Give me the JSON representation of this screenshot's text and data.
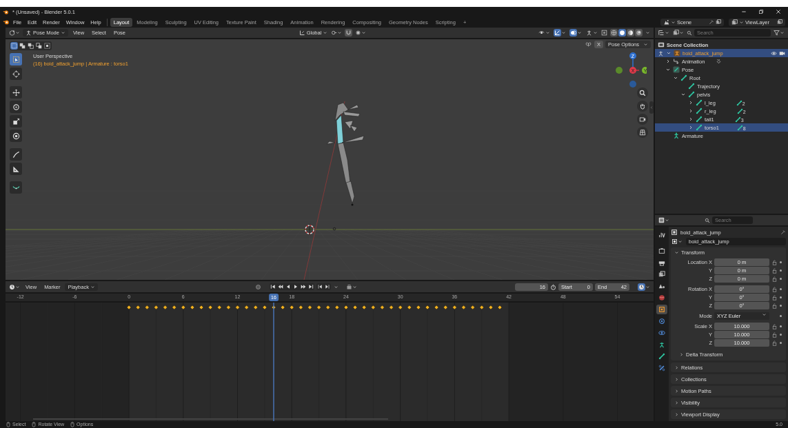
{
  "window": {
    "title": "* (Unsaved) - Blender 5.0.1"
  },
  "menu": [
    "File",
    "Edit",
    "Render",
    "Window",
    "Help"
  ],
  "workspaces": [
    {
      "label": "Layout",
      "selected": true
    },
    {
      "label": "Modeling",
      "selected": false
    },
    {
      "label": "Sculpting",
      "selected": false
    },
    {
      "label": "UV Editing",
      "selected": false
    },
    {
      "label": "Texture Paint",
      "selected": false
    },
    {
      "label": "Shading",
      "selected": false
    },
    {
      "label": "Animation",
      "selected": false
    },
    {
      "label": "Rendering",
      "selected": false
    },
    {
      "label": "Compositing",
      "selected": false
    },
    {
      "label": "Geometry Nodes",
      "selected": false
    },
    {
      "label": "Scripting",
      "selected": false
    }
  ],
  "add_workspace": "+",
  "scene": "Scene",
  "view_layer": "ViewLayer",
  "viewport": {
    "mode": "Pose Mode",
    "menus": [
      "View",
      "Select",
      "Pose"
    ],
    "orientation": "Global",
    "pose_options": "Pose Options",
    "mirror_toggle": "X",
    "select_modes": [
      {
        "selected": true
      },
      {
        "selected": false
      },
      {
        "selected": false
      },
      {
        "selected": false
      },
      {
        "selected": false
      }
    ],
    "shading": [
      {
        "kind": "wireframe",
        "selected": false
      },
      {
        "kind": "solid",
        "selected": true
      },
      {
        "kind": "material",
        "selected": false
      },
      {
        "kind": "rendered",
        "selected": false
      }
    ],
    "tools": [
      {
        "kind": "select",
        "selected": true
      },
      {
        "kind": "cursor",
        "selected": false
      },
      {
        "kind": "move",
        "selected": false
      },
      {
        "kind": "rotate",
        "selected": false
      },
      {
        "kind": "scale",
        "selected": false
      },
      {
        "kind": "transform",
        "selected": false
      },
      {
        "kind": "annotate",
        "selected": false
      },
      {
        "kind": "measure",
        "selected": false
      },
      {
        "kind": "relax",
        "selected": false
      }
    ],
    "view_name": "User Perspective",
    "info": "(16) boid_attack_jump | Armature : torso1",
    "gizmo_labels": [
      "Z",
      "X",
      "Y"
    ]
  },
  "outliner": {
    "search_placeholder": "Search",
    "root": "Scene Collection",
    "items": [
      {
        "label": "boid_attack_jump",
        "kind": "armature_object",
        "selected": true,
        "expanded": true,
        "children": [
          {
            "label": "Animation",
            "kind": "animation",
            "selected": false,
            "expanded": false
          },
          {
            "label": "Pose",
            "kind": "pose",
            "selected": false,
            "expanded": true,
            "children": [
              {
                "label": "Root",
                "kind": "bone",
                "selected": false,
                "expanded": true,
                "children": [
                  {
                    "label": "Trajectory",
                    "kind": "bone",
                    "selected": false
                  },
                  {
                    "label": "pelvis",
                    "kind": "bone",
                    "selected": false,
                    "expanded": true,
                    "children": [
                      {
                        "label": "l_leg",
                        "kind": "bone",
                        "selected": false,
                        "expanded": false,
                        "count": "2"
                      },
                      {
                        "label": "r_leg",
                        "kind": "bone",
                        "selected": false,
                        "expanded": false,
                        "count": "2"
                      },
                      {
                        "label": "tail1",
                        "kind": "bone",
                        "selected": false,
                        "expanded": false,
                        "count": "3"
                      },
                      {
                        "label": "torso1",
                        "kind": "bone",
                        "selected": true,
                        "expanded": false,
                        "count": "8"
                      }
                    ]
                  }
                ]
              }
            ]
          },
          {
            "label": "Armature",
            "kind": "armature_data",
            "selected": false
          }
        ]
      }
    ]
  },
  "properties": {
    "search_placeholder": "Search",
    "tabs": [
      {
        "kind": "tool",
        "selected": false
      },
      {
        "kind": "render",
        "selected": false
      },
      {
        "kind": "output",
        "selected": false
      },
      {
        "kind": "view_layer",
        "selected": false
      },
      {
        "kind": "scene",
        "selected": false
      },
      {
        "kind": "world",
        "selected": false
      },
      {
        "kind": "object",
        "selected": true
      },
      {
        "kind": "modifiers",
        "selected": false
      },
      {
        "kind": "physics",
        "selected": false
      },
      {
        "kind": "armature",
        "selected": false
      },
      {
        "kind": "bone",
        "selected": false
      },
      {
        "kind": "constraints",
        "selected": false
      }
    ],
    "object_name": "boid_attack_jump",
    "datablock": "boid_attack_jump",
    "panels": [
      {
        "title": "Transform",
        "expanded": true,
        "groups": [
          [
            {
              "label": "Location X",
              "value": "0 m",
              "kind": "number"
            },
            {
              "label": "Y",
              "value": "0 m",
              "kind": "number"
            },
            {
              "label": "Z",
              "value": "0 m",
              "kind": "number"
            }
          ],
          [
            {
              "label": "Rotation X",
              "value": "0°",
              "kind": "number"
            },
            {
              "label": "Y",
              "value": "0°",
              "kind": "number"
            },
            {
              "label": "Z",
              "value": "0°",
              "kind": "number"
            }
          ],
          [
            {
              "label": "Mode",
              "value": "XYZ Euler",
              "kind": "dropdown"
            }
          ],
          [
            {
              "label": "Scale X",
              "value": "10.000",
              "kind": "number"
            },
            {
              "label": "Y",
              "value": "10.000",
              "kind": "number"
            },
            {
              "label": "Z",
              "value": "10.000",
              "kind": "number"
            }
          ]
        ],
        "subpanels": [
          {
            "title": "Delta Transform",
            "expanded": false
          }
        ]
      },
      {
        "title": "Relations",
        "expanded": false
      },
      {
        "title": "Collections",
        "expanded": false
      },
      {
        "title": "Motion Paths",
        "expanded": false
      },
      {
        "title": "Visibility",
        "expanded": false
      },
      {
        "title": "Viewport Display",
        "expanded": false
      }
    ]
  },
  "timeline": {
    "menus": [
      "View",
      "Marker",
      "Playback"
    ],
    "current_frame": "16",
    "start_label": "Start",
    "start": "0",
    "end_label": "End",
    "end": "42",
    "ruler": [
      "-12",
      "-6",
      "0",
      "6",
      "12",
      "18",
      "24",
      "30",
      "36",
      "42",
      "48",
      "54"
    ],
    "playhead": "16"
  },
  "status": [
    "Select",
    "Rotate View",
    "Options"
  ],
  "version": "5.0"
}
